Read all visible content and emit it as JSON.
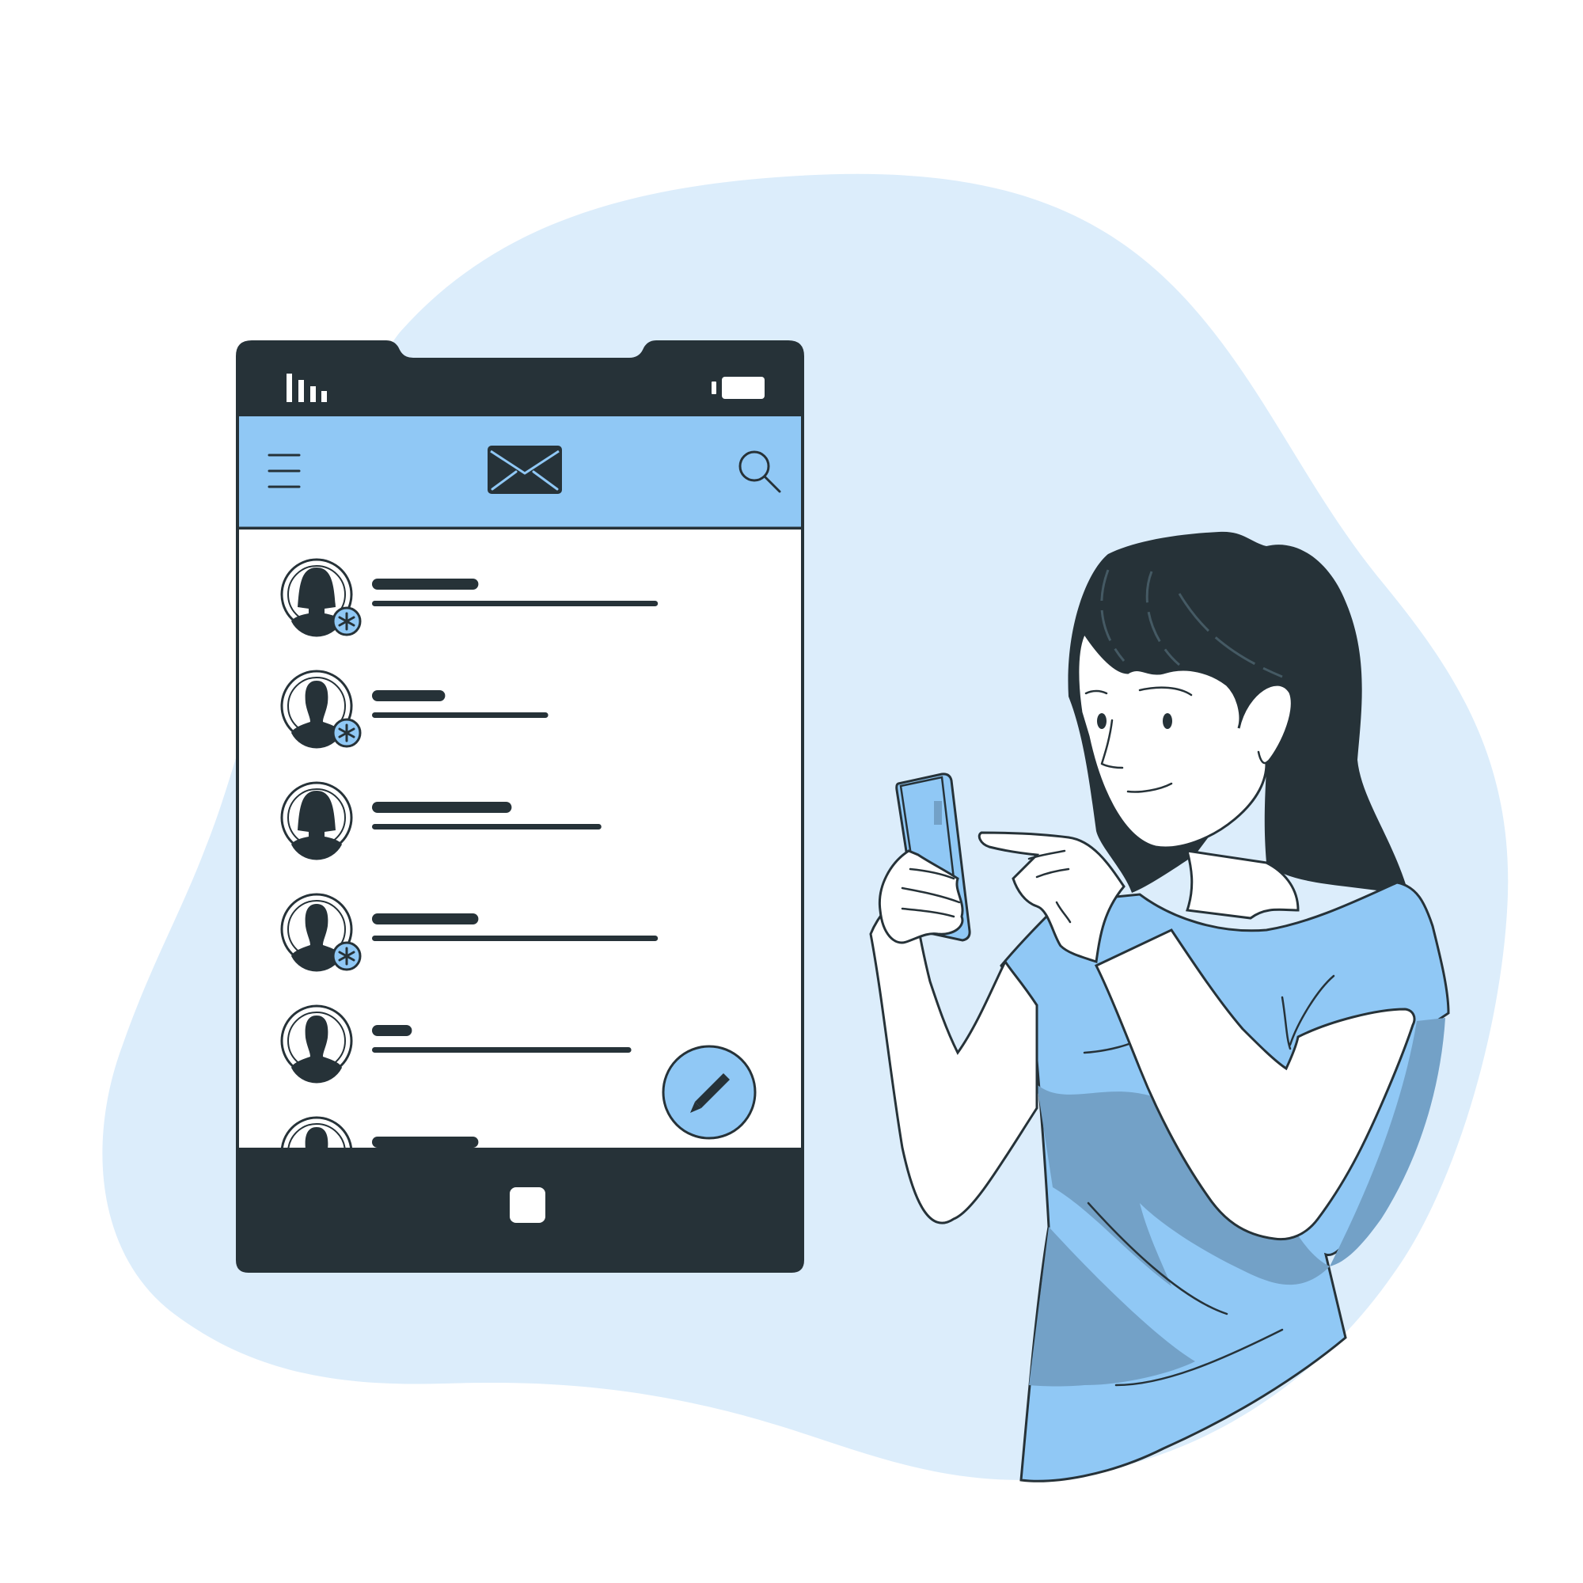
{
  "colors": {
    "background_blob": "#dcedfb",
    "accent_blue": "#90c8f5",
    "shirt_shadow": "#73a1c7",
    "ink": "#263238",
    "white": "#ffffff"
  },
  "phone": {
    "status_bar": {
      "signal_icon": "signal-bars-icon",
      "battery_icon": "battery-icon"
    },
    "app_bar": {
      "menu_icon": "hamburger-menu-icon",
      "logo_icon": "envelope-icon",
      "search_icon": "search-icon"
    },
    "inbox": [
      {
        "avatar": "female",
        "new_badge": true,
        "name_len": 0.32,
        "preview_len": 0.86
      },
      {
        "avatar": "male",
        "new_badge": true,
        "name_len": 0.22,
        "preview_len": 0.53
      },
      {
        "avatar": "female",
        "new_badge": false,
        "name_len": 0.42,
        "preview_len": 0.69
      },
      {
        "avatar": "male",
        "new_badge": true,
        "name_len": 0.32,
        "preview_len": 0.86
      },
      {
        "avatar": "male",
        "new_badge": false,
        "name_len": 0.12,
        "preview_len": 0.78
      },
      {
        "avatar": "male",
        "new_badge": false,
        "name_len": 0.32,
        "preview_len": 0.0
      }
    ],
    "compose_fab_icon": "pencil-icon",
    "home_button_icon": "home-button-icon"
  },
  "illustration": {
    "person": "woman-using-smartphone"
  }
}
